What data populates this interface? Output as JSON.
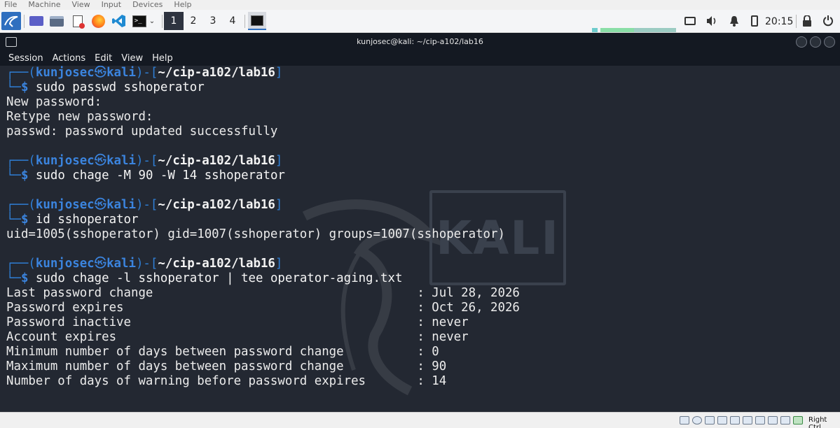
{
  "host_menu": [
    "File",
    "Machine",
    "View",
    "Input",
    "Devices",
    "Help"
  ],
  "taskbar": {
    "apps": [
      {
        "name": "kali-menu-icon"
      },
      {
        "name": "desktop-icon"
      },
      {
        "name": "file-manager-icon"
      },
      {
        "name": "text-editor-icon"
      },
      {
        "name": "firefox-icon"
      },
      {
        "name": "vscode-icon"
      },
      {
        "name": "terminal-launcher-icon"
      }
    ],
    "workspaces": [
      "1",
      "2",
      "3",
      "4"
    ],
    "active_workspace": "1",
    "clock": "20:15"
  },
  "window": {
    "title": "kunjosec@kali: ~/cip-a102/lab16",
    "menu": [
      "Session",
      "Actions",
      "Edit",
      "View",
      "Help"
    ]
  },
  "terminal": {
    "prompt_user": "kunjosec",
    "prompt_host": "kali",
    "prompt_path": "~/cip-a102/lab16",
    "blocks": [
      {
        "command": "sudo passwd sshoperator",
        "output": [
          "New password:",
          "Retype new password:",
          "passwd: password updated successfully"
        ]
      },
      {
        "command": "sudo chage -M 90 -W 14 sshoperator",
        "output": []
      },
      {
        "command": "id sshoperator",
        "output": [
          "uid=1005(sshoperator) gid=1007(sshoperator) groups=1007(sshoperator)"
        ]
      },
      {
        "command": "sudo chage -l sshoperator | tee operator-aging.txt",
        "output": [
          "Last password change                                    : Jul 28, 2026",
          "Password expires                                        : Oct 26, 2026",
          "Password inactive                                       : never",
          "Account expires                                         : never",
          "Minimum number of days between password change          : 0",
          "Maximum number of days between password change          : 90",
          "Number of days of warning before password expires       : 14"
        ]
      }
    ],
    "background_logo_text": "KALI"
  },
  "vbox_status": {
    "host_key": "Right Ctrl"
  },
  "colors": {
    "terminal_bg": "#232832",
    "prompt_blue": "#3b84de",
    "text": "#ececec"
  }
}
